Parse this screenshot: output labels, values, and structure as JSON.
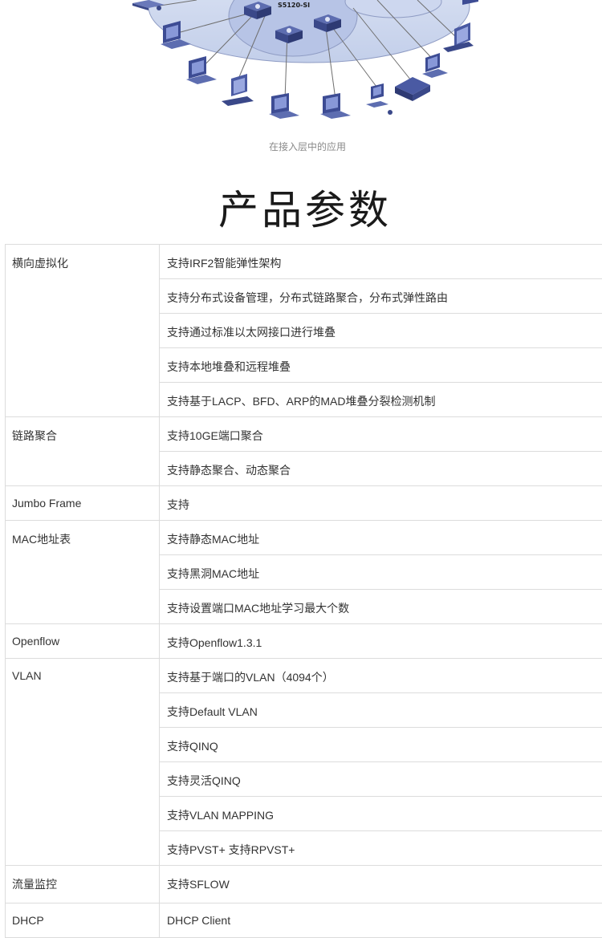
{
  "diagram": {
    "switch_label": "S5120-SI",
    "device_icons": [
      "switch-icon",
      "desktop-pc-icon",
      "laptop-icon",
      "ip-phone-icon",
      "thin-client-icon",
      "keyboard-icon"
    ]
  },
  "caption": "在接入层中的应用",
  "heading": "产品参数",
  "specs": [
    {
      "label": "横向虚拟化",
      "values": [
        "支持IRF2智能弹性架构",
        "支持分布式设备管理，分布式链路聚合，分布式弹性路由",
        "支持通过标准以太网接口进行堆叠",
        "支持本地堆叠和远程堆叠",
        "支持基于LACP、BFD、ARP的MAD堆叠分裂检测机制"
      ]
    },
    {
      "label": "链路聚合",
      "values": [
        "支持10GE端口聚合",
        "支持静态聚合、动态聚合"
      ]
    },
    {
      "label": "Jumbo Frame",
      "values": [
        "支持"
      ]
    },
    {
      "label": "MAC地址表",
      "values": [
        "支持静态MAC地址",
        "支持黑洞MAC地址",
        "支持设置端口MAC地址学习最大个数"
      ]
    },
    {
      "label": "Openflow",
      "values": [
        "支持Openflow1.3.1"
      ]
    },
    {
      "label": "VLAN",
      "values": [
        "支持基于端口的VLAN（4094个）",
        "支持Default VLAN",
        "支持QINQ",
        "支持灵活QINQ",
        "支持VLAN MAPPING",
        "支持PVST+ 支持RPVST+"
      ]
    },
    {
      "label": "流量监控",
      "values": [
        "支持SFLOW"
      ]
    },
    {
      "label": "DHCP",
      "values": [
        "DHCP Client"
      ]
    }
  ]
}
